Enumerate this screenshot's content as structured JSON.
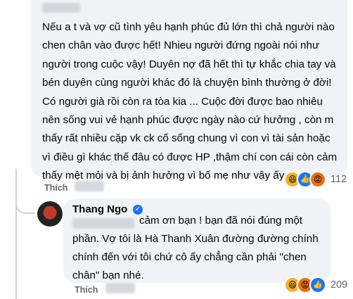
{
  "comment1": {
    "text": "Nếu a t và vợ cũ tình yêu hạnh phúc đủ lớn thì chả người nào chen chân vào được hết! Nhieu người đứng ngoài nói như người trong cuộc vậy! Duyên nợ đã hết thì tự khắc chia tay và bén duyên cùng người khác đó là chuyện bình thường ở đời! Có người già rồi còn ra tòa kia ... Cuộc đời được bao nhiêu nên sống vui vẻ hạnh phúc được ngày nào cứ hưởng , còn m thấy rất nhiều cặp vk ck cố sống chung vì con vì tài sản hoặc vì điều gì khác thế đâu có được HP ,thậm chí con cái còn cảm thấy mệt mỏi và bị ảnh hưởng vì bố mẹ như vậy ấy .",
    "action_label": "Thích",
    "reaction_count": "112",
    "reaction_icons": [
      "haha-icon",
      "like-icon",
      "angry-icon"
    ],
    "colors": {
      "like": "#1877f2",
      "haha": "#f7b125",
      "angry": "#e9710f"
    }
  },
  "comment2": {
    "author": "Thang Ngo",
    "text_first": "cảm ơn bạn ! bạn đã nói đúng một",
    "text_rest": "phần. Vợ tôi là Hà Thanh Xuân đường đường chính chính đến với tôi chứ cô ấy chẳng cần phải \"chen chân\" bạn nhé.",
    "action_label": "Thích",
    "reaction_count": "209",
    "reaction_icons": [
      "haha-icon",
      "angry-icon",
      "like-icon"
    ]
  },
  "theme": {
    "bubble_bg": "#f0f2f5",
    "secondary_text": "#65676b",
    "verified": "#1877f2"
  }
}
